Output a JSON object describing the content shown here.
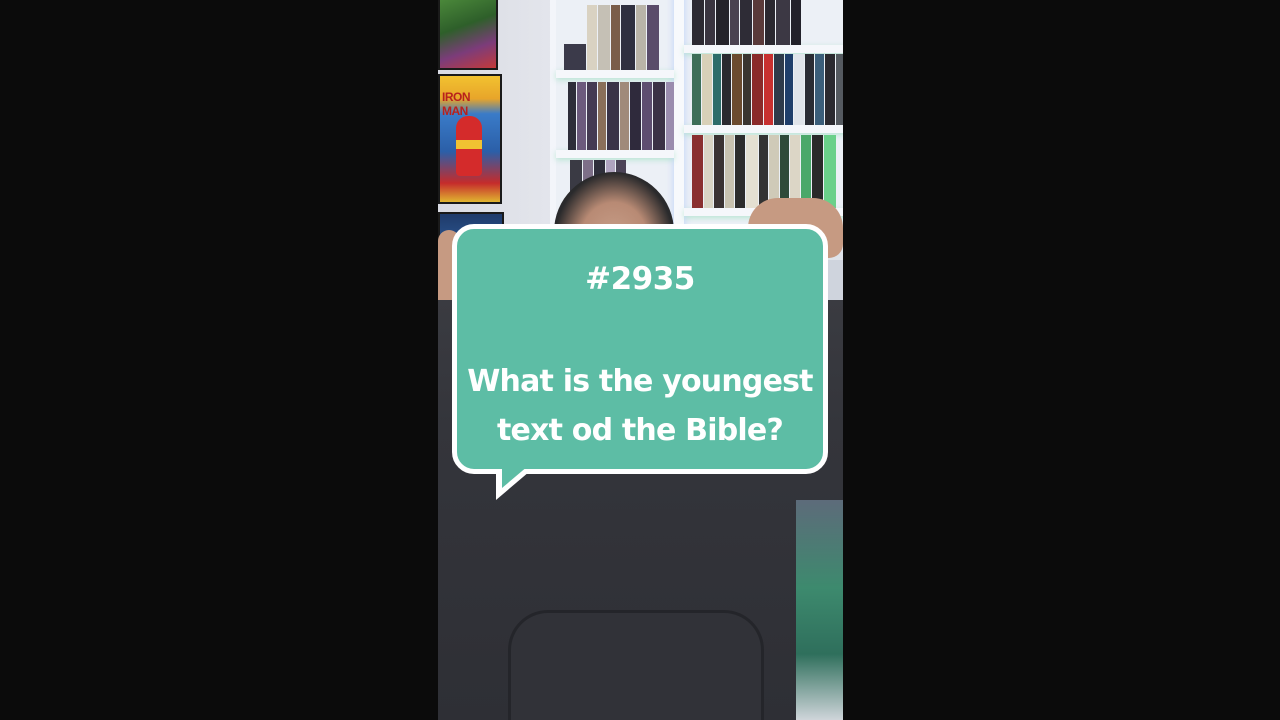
{
  "video": {
    "bubble": {
      "number": "#2935",
      "question_line1": "What is the youngest",
      "question_line2": "text od the Bible?"
    },
    "background": {
      "poster_label": "IRON MAN"
    }
  },
  "colors": {
    "bubble_fill": "#5dbda5",
    "bubble_border": "#ffffff",
    "text": "#ffffff",
    "letterbox": "#0b0b0b"
  },
  "icons": []
}
